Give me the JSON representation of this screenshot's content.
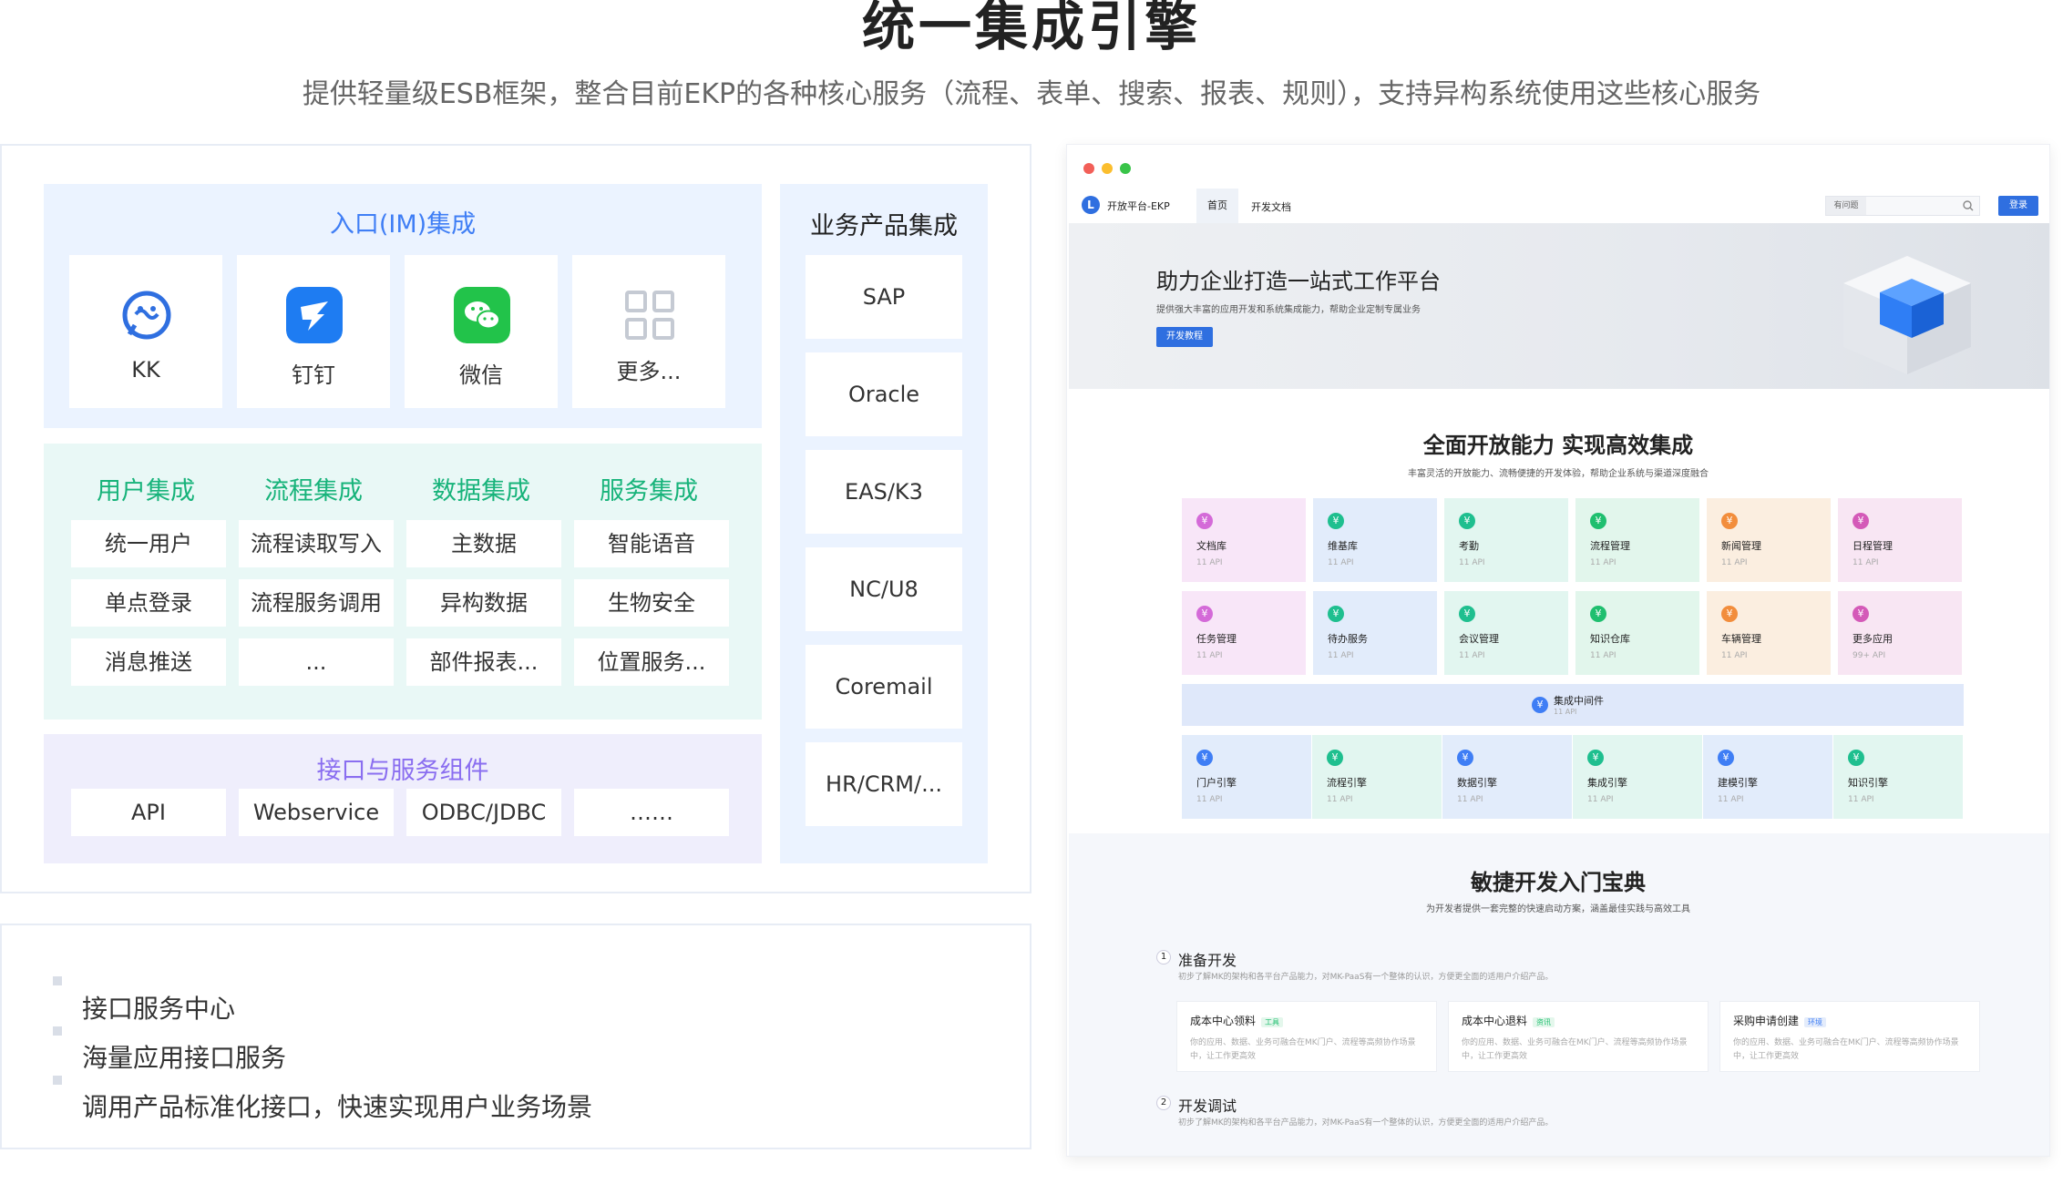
{
  "header": {
    "title": "统一集成引擎",
    "subtitle": "提供轻量级ESB框架，整合目前EKP的各种核心服务（流程、表单、搜索、报表、规则），支持异构系统使用这些核心服务"
  },
  "im": {
    "title": "入口(IM)集成",
    "items": [
      {
        "label": "KK",
        "icon": "kk-icon"
      },
      {
        "label": "钉钉",
        "icon": "dingtalk-icon"
      },
      {
        "label": "微信",
        "icon": "wechat-icon"
      },
      {
        "label": "更多...",
        "icon": "grid-icon"
      }
    ]
  },
  "integration": {
    "columns": [
      {
        "title": "用户集成",
        "items": [
          "统一用户",
          "单点登录",
          "消息推送"
        ]
      },
      {
        "title": "流程集成",
        "items": [
          "流程读取写入",
          "流程服务调用",
          "..."
        ]
      },
      {
        "title": "数据集成",
        "items": [
          "主数据",
          "异构数据",
          "部件报表..."
        ]
      },
      {
        "title": "服务集成",
        "items": [
          "智能语音",
          "生物安全",
          "位置服务..."
        ]
      }
    ]
  },
  "api": {
    "title": "接口与服务组件",
    "items": [
      "API",
      "Webservice",
      "ODBC/JDBC",
      "……"
    ]
  },
  "products": {
    "title": "业务产品集成",
    "items": [
      "SAP",
      "Oracle",
      "EAS/K3",
      "NC/U8",
      "Coremail",
      "HR/CRM/..."
    ]
  },
  "features": [
    "接口服务中心",
    "海量应用接口服务",
    "调用产品标准化接口，快速实现用户业务场景"
  ],
  "screenshot": {
    "logo_letter": "L",
    "brand": "开放平台-EKP",
    "tabs": [
      "首页",
      "开发文档"
    ],
    "search_label": "有问题",
    "login": "登录",
    "banner_title": "助力企业打造一站式工作平台",
    "banner_sub": "提供强大丰富的应用开发和系统集成能力，帮助企业定制专属业务",
    "banner_button": "开发教程",
    "section1_title": "全面开放能力 实现高效集成",
    "section1_sub": "丰富灵活的开放能力、流畅便捷的开发体验，帮助企业系统与渠道深度融合",
    "row1": [
      {
        "name": "文档库",
        "sub": "11 API",
        "color": "#f8e6f8",
        "icon_color": "#d46ad8"
      },
      {
        "name": "维基库",
        "sub": "11 API",
        "color": "#e2ecfb",
        "icon_color": "#1fbf8f"
      },
      {
        "name": "考勤",
        "sub": "11 API",
        "color": "#e2f6f0",
        "icon_color": "#1fbf8f"
      },
      {
        "name": "流程管理",
        "sub": "11 API",
        "color": "#e2f6ec",
        "icon_color": "#1fbf6f"
      },
      {
        "name": "新闻管理",
        "sub": "11 API",
        "color": "#fbeee0",
        "icon_color": "#f28d3c"
      },
      {
        "name": "日程管理",
        "sub": "11 API",
        "color": "#f8e6f3",
        "icon_color": "#d45ab8"
      }
    ],
    "row2": [
      {
        "name": "任务管理",
        "sub": "11 API",
        "color": "#f8e6f8",
        "icon_color": "#d46ad8"
      },
      {
        "name": "待办服务",
        "sub": "11 API",
        "color": "#e2ecfb",
        "icon_color": "#1fbf8f"
      },
      {
        "name": "会议管理",
        "sub": "11 API",
        "color": "#e2f6f0",
        "icon_color": "#1fbf8f"
      },
      {
        "name": "知识仓库",
        "sub": "11 API",
        "color": "#e2f6ec",
        "icon_color": "#1fbf6f"
      },
      {
        "name": "车辆管理",
        "sub": "11 API",
        "color": "#fbeee0",
        "icon_color": "#f28d3c"
      },
      {
        "name": "更多应用",
        "sub": "99+ API",
        "color": "#f8e6f3",
        "icon_color": "#d45ab8"
      }
    ],
    "middleware": {
      "name": "集成中间件",
      "sub": "11 API"
    },
    "row3": [
      {
        "name": "门户引擎",
        "sub": "11 API",
        "color": "#e2ecfb",
        "icon_color": "#3f7ef5"
      },
      {
        "name": "流程引擎",
        "sub": "11 API",
        "color": "#e2f6f0",
        "icon_color": "#1fbf8f"
      },
      {
        "name": "数据引擎",
        "sub": "11 API",
        "color": "#e2ecfb",
        "icon_color": "#3f7ef5"
      },
      {
        "name": "集成引擎",
        "sub": "11 API",
        "color": "#e2f6f0",
        "icon_color": "#1fbf8f"
      },
      {
        "name": "建模引擎",
        "sub": "11 API",
        "color": "#e2ecfb",
        "icon_color": "#3f7ef5"
      },
      {
        "name": "知识引擎",
        "sub": "11 API",
        "color": "#e2f6f0",
        "icon_color": "#1fbf8f"
      }
    ],
    "section2_title": "敏捷开发入门宝典",
    "section2_sub": "为开发者提供一套完整的快速启动方案，涵盖最佳实践与高效工具",
    "step1_num": "1",
    "step1_title": "准备开发",
    "step1_desc": "初步了解MK的架构和各平台产品能力，对MK-PaaS有一个整体的认识，方便更全面的适用户介绍产品。",
    "tutorials": [
      {
        "title": "成本中心领料",
        "tag": "工具",
        "tag_color": "#1fbf6f",
        "desc": "你的应用、数据、业务可融合在MK门户、流程等高频协作场景中，让工作更高效"
      },
      {
        "title": "成本中心退料",
        "tag": "资讯",
        "tag_color": "#1fbf6f",
        "desc": "你的应用、数据、业务可融合在MK门户、流程等高频协作场景中，让工作更高效"
      },
      {
        "title": "采购申请创建",
        "tag": "环境",
        "tag_color": "#3f7ef5",
        "desc": "你的应用、数据、业务可融合在MK门户、流程等高频协作场景中，让工作更高效"
      }
    ],
    "step2_num": "2",
    "step2_title": "开发调试",
    "step2_desc": "初步了解MK的架构和各平台产品能力，对MK-PaaS有一个整体的认识，方便更全面的适用户介绍产品。"
  }
}
